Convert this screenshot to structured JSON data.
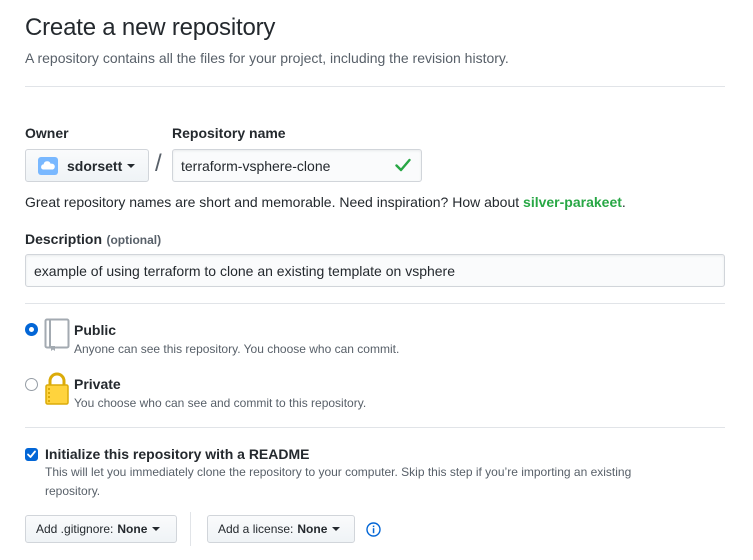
{
  "header": {
    "title": "Create a new repository",
    "subtitle": "A repository contains all the files for your project, including the revision history."
  },
  "owner": {
    "label": "Owner",
    "value": "sdorsett"
  },
  "separator": "/",
  "repo_name": {
    "label": "Repository name",
    "value": "terraform-vsphere-clone"
  },
  "name_hint": {
    "text": "Great repository names are short and memorable. Need inspiration? How about ",
    "suggestion": "silver-parakeet",
    "end": "."
  },
  "description": {
    "label": "Description",
    "optional": "(optional)",
    "value": "example of using terraform to clone an existing template on vsphere"
  },
  "visibility": {
    "public": {
      "label": "Public",
      "desc": "Anyone can see this repository. You choose who can commit.",
      "selected": true
    },
    "private": {
      "label": "Private",
      "desc": "You choose who can see and commit to this repository.",
      "selected": false
    }
  },
  "readme": {
    "label": "Initialize this repository with a README",
    "desc_line1": "This will let you immediately clone the repository to your computer. Skip this step if you’re importing an existing",
    "desc_line2": "repository.",
    "checked": true
  },
  "gitignore": {
    "prefix": "Add .gitignore:",
    "value": "None"
  },
  "license": {
    "prefix": "Add a license:",
    "value": "None"
  },
  "colors": {
    "accent": "#0366d6",
    "success": "#28a745"
  }
}
